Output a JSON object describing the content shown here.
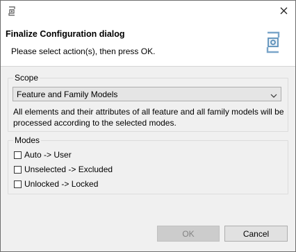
{
  "window": {
    "title_icon": "app-config-icon",
    "close_icon": "close-icon"
  },
  "header": {
    "title": "Finalize Configuration dialog",
    "message": "Please select action(s), then press OK.",
    "icon": "configuration-icon"
  },
  "scope": {
    "legend": "Scope",
    "selected": "Feature and Family Models",
    "description": "All elements and their attributes of all feature and all family models will be processed according to the selected modes."
  },
  "modes": {
    "legend": "Modes",
    "options": [
      {
        "label": "Auto -> User",
        "checked": false
      },
      {
        "label": "Unselected -> Excluded",
        "checked": false
      },
      {
        "label": "Unlocked -> Locked",
        "checked": false
      }
    ]
  },
  "buttons": {
    "ok": "OK",
    "cancel": "Cancel",
    "ok_enabled": false
  },
  "colors": {
    "header_bg": "#ffffff",
    "dialog_bg": "#f0f0f0",
    "icon_blue": "#5b8fb9"
  }
}
